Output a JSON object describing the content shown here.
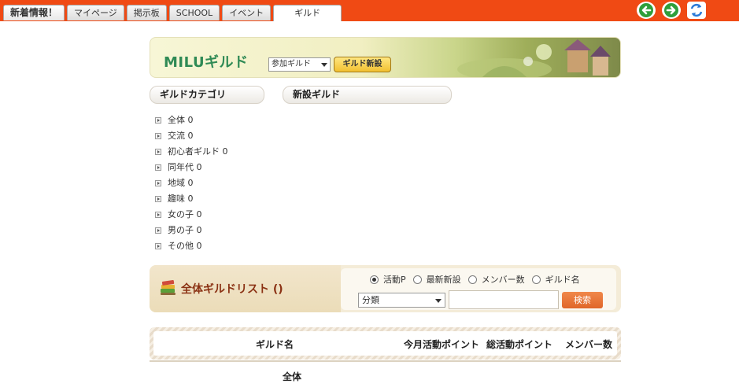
{
  "top_tabs": [
    "新着情報！",
    "マイページ",
    "掲示板",
    "SCHOOL",
    "イベント",
    "ギルド"
  ],
  "nav_icons": [
    "back-arrow-icon",
    "forward-arrow-icon",
    "refresh-icon"
  ],
  "banner": {
    "title": "MILUギルド",
    "join_select": "参加ギルド",
    "new_guild_button": "ギルド新設"
  },
  "sections": {
    "category_header": "ギルドカテゴリ",
    "new_guild_header": "新設ギルド"
  },
  "categories": [
    "全体 0",
    "交流 0",
    "初心者ギルド 0",
    "同年代 0",
    "地域 0",
    "趣味 0",
    "女の子 0",
    "男の子 0",
    "その他 0"
  ],
  "guild_list": {
    "title": "全体ギルドリスト ()",
    "sort_options": [
      "活動P",
      "最新新設",
      "メンバー数",
      "ギルド名"
    ],
    "sort_selected": "活動P",
    "classification_select": "分類",
    "search_value": "",
    "search_button": "検索",
    "columns": [
      "ギルド名",
      "今月活動ポイント",
      "総活動ポイント",
      "メンバー数"
    ],
    "group_label": "全体"
  },
  "colors": {
    "topbar": "#f04a14",
    "guild_title": "#2f8a55",
    "list_title": "#8b3214",
    "search_button": "#e0662a"
  }
}
